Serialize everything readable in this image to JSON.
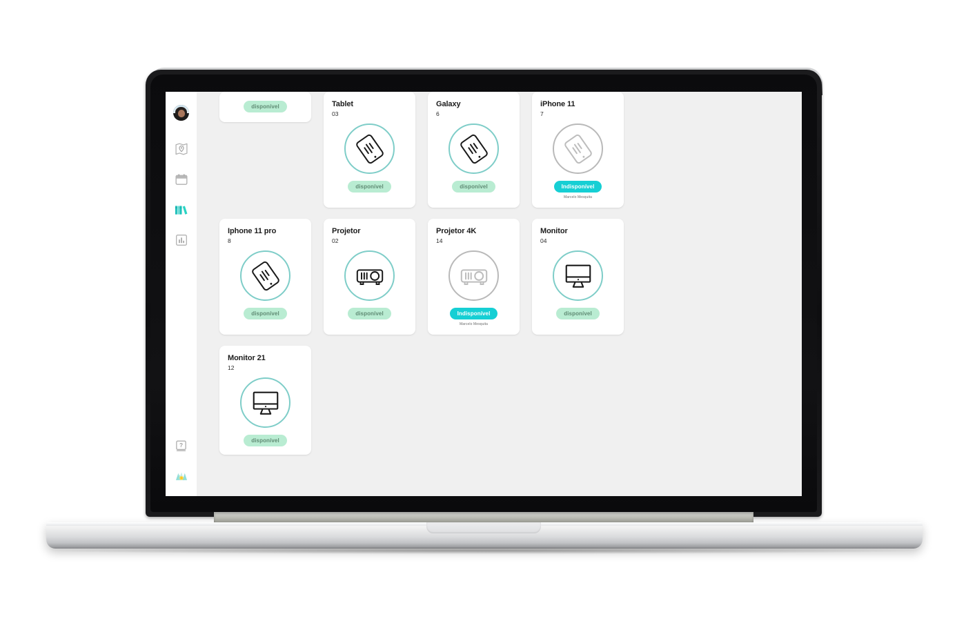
{
  "app": {
    "accent_teal": "#16cfd4",
    "ring_teal": "#7ecdc8",
    "ring_gray": "#b9b9b9",
    "badge_available_bg": "#b9ecd2",
    "badge_available_text": "#5f8a73",
    "badge_unavailable_bg": "#16cfd4",
    "background": "#f0f0f0",
    "sidebar_bg": "#ffffff"
  },
  "sidebar": {
    "avatar": {
      "name": "user-avatar",
      "label": "User profile"
    },
    "items": [
      {
        "id": "map",
        "icon": "map-pin-icon",
        "label": "Mapa",
        "active": false
      },
      {
        "id": "calendar",
        "icon": "calendar-icon",
        "label": "Agenda",
        "active": false
      },
      {
        "id": "library",
        "icon": "books-icon",
        "label": "Acervo",
        "active": true
      },
      {
        "id": "reports",
        "icon": "bar-chart-icon",
        "label": "Relatórios",
        "active": false
      }
    ],
    "bottom_items": [
      {
        "id": "help",
        "icon": "help-book-icon",
        "label": "Ajuda"
      },
      {
        "id": "brand",
        "icon": "brand-logo-icon",
        "label": "Logo"
      }
    ]
  },
  "cards": [
    {
      "id": "partial-top",
      "title": "",
      "code": "",
      "icon": "tablet-icon",
      "status": "disponível",
      "available": true,
      "holder": "",
      "partial": true
    },
    {
      "id": "tablet",
      "title": "Tablet",
      "code": "03",
      "icon": "tablet-icon",
      "status": "disponível",
      "available": true,
      "holder": "",
      "partial": false
    },
    {
      "id": "galaxy",
      "title": "Galaxy",
      "code": "6",
      "icon": "tablet-icon",
      "status": "disponível",
      "available": true,
      "holder": "",
      "partial": false
    },
    {
      "id": "iphone-11",
      "title": "iPhone 11",
      "code": "7",
      "icon": "tablet-icon",
      "status": "Indisponível",
      "available": false,
      "holder": "Marcelo Mesquita",
      "partial": false
    },
    {
      "id": "iphone-11-pro",
      "title": "Iphone 11 pro",
      "code": "8",
      "icon": "tablet-icon",
      "status": "disponível",
      "available": true,
      "holder": "",
      "partial": false
    },
    {
      "id": "projetor",
      "title": "Projetor",
      "code": "02",
      "icon": "projector-icon",
      "status": "disponível",
      "available": true,
      "holder": "",
      "partial": false
    },
    {
      "id": "projetor-4k",
      "title": "Projetor 4K",
      "code": "14",
      "icon": "projector-icon",
      "status": "Indisponível",
      "available": false,
      "holder": "Marcelo Mesquita",
      "partial": false
    },
    {
      "id": "monitor",
      "title": "Monitor",
      "code": "04",
      "icon": "monitor-icon",
      "status": "disponível",
      "available": true,
      "holder": "",
      "partial": false
    },
    {
      "id": "monitor-21",
      "title": "Monitor 21",
      "code": "12",
      "icon": "monitor-icon",
      "status": "disponível",
      "available": true,
      "holder": "",
      "partial": false
    }
  ]
}
